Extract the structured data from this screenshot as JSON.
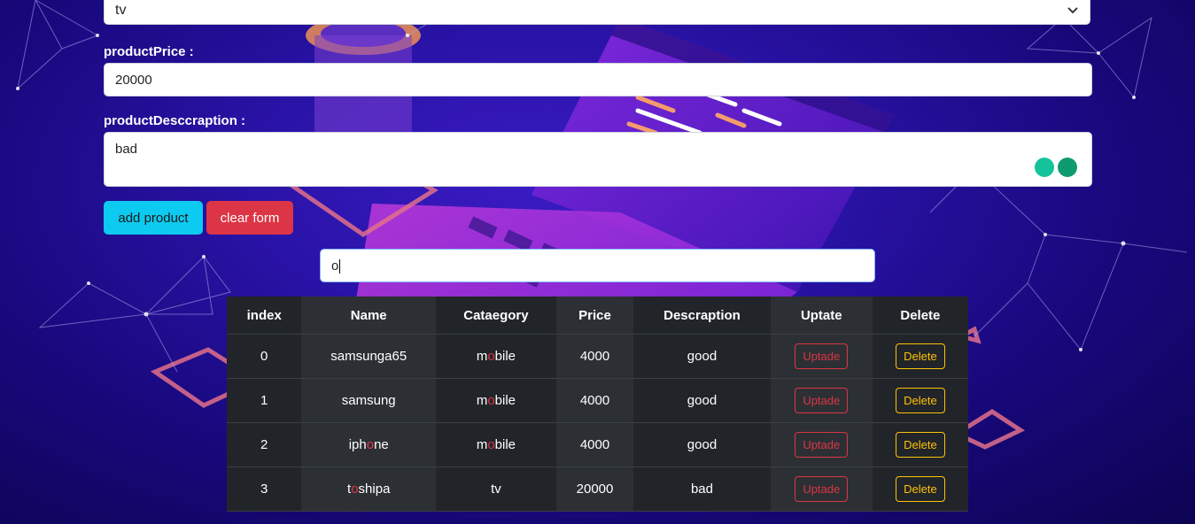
{
  "form": {
    "category_value": "tv",
    "price_label": "productPrice :",
    "price_value": "20000",
    "description_label": "productDesccraption :",
    "description_value": "bad",
    "add_button": "add product",
    "clear_button": "clear form"
  },
  "search": {
    "value": "o"
  },
  "table": {
    "headers": [
      "index",
      "Name",
      "Cataegory",
      "Price",
      "Descraption",
      "Uptate",
      "Delete"
    ],
    "rows": [
      {
        "index": "0",
        "name_pre": "samsunga65",
        "name_hl": "",
        "name_post": "",
        "cat_pre": "m",
        "cat_hl": "o",
        "cat_post": "bile",
        "price": "4000",
        "desc": "good",
        "update": "Uptade",
        "delete": "Delete"
      },
      {
        "index": "1",
        "name_pre": "samsung",
        "name_hl": "",
        "name_post": "",
        "cat_pre": "m",
        "cat_hl": "o",
        "cat_post": "bile",
        "price": "4000",
        "desc": "good",
        "update": "Uptade",
        "delete": "Delete"
      },
      {
        "index": "2",
        "name_pre": "iph",
        "name_hl": "o",
        "name_post": "ne",
        "cat_pre": "m",
        "cat_hl": "o",
        "cat_post": "bile",
        "price": "4000",
        "desc": "good",
        "update": "Uptade",
        "delete": "Delete"
      },
      {
        "index": "3",
        "name_pre": "t",
        "name_hl": "o",
        "name_post": "shipa",
        "cat_pre": "tv",
        "cat_hl": "",
        "cat_post": "",
        "price": "20000",
        "desc": "bad",
        "update": "Uptade",
        "delete": "Delete"
      }
    ]
  },
  "colors": {
    "bg_dark": "#0c0452",
    "bg_accent": "#3a1bc4",
    "highlight": "#dc3545",
    "add_button": "#0dcaf0",
    "clear_button": "#dc3545",
    "delete_outline": "#ffc107"
  }
}
